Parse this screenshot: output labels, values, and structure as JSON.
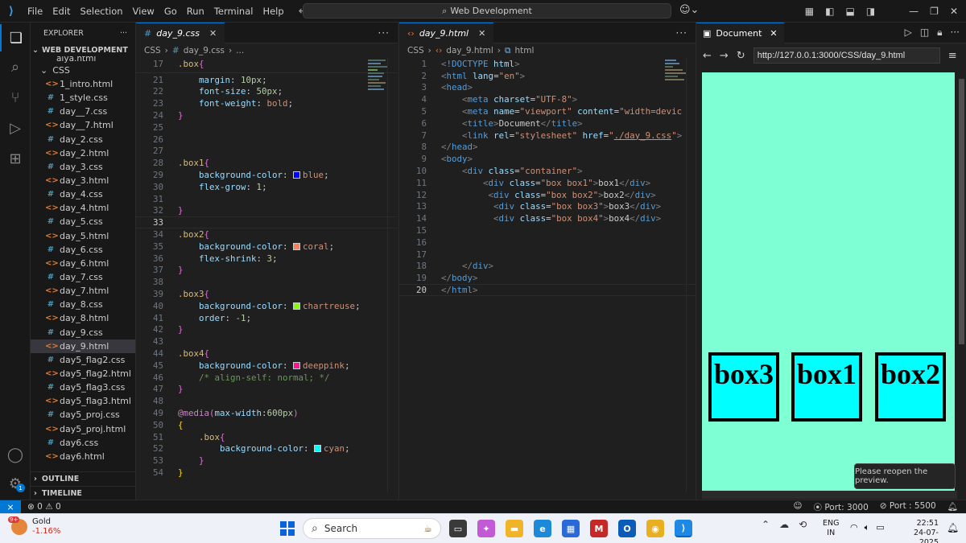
{
  "titlebar": {
    "menu": [
      "File",
      "Edit",
      "Selection",
      "View",
      "Go",
      "Run",
      "Terminal",
      "Help"
    ],
    "search": "Web Development"
  },
  "explorer": {
    "header": "EXPLORER",
    "folder": "WEB DEVELOPMENT",
    "clipped_item": "aiya.html",
    "subfolder": "CSS",
    "files": [
      {
        "name": "1_intro.html",
        "type": "html"
      },
      {
        "name": "1_style.css",
        "type": "css"
      },
      {
        "name": "day__7.css",
        "type": "css"
      },
      {
        "name": "day__7.html",
        "type": "html"
      },
      {
        "name": "day_2.css",
        "type": "css"
      },
      {
        "name": "day_2.html",
        "type": "html"
      },
      {
        "name": "day_3.css",
        "type": "css"
      },
      {
        "name": "day_3.html",
        "type": "html"
      },
      {
        "name": "day_4.css",
        "type": "css"
      },
      {
        "name": "day_4.html",
        "type": "html"
      },
      {
        "name": "day_5.css",
        "type": "css"
      },
      {
        "name": "day_5.html",
        "type": "html"
      },
      {
        "name": "day_6.css",
        "type": "css"
      },
      {
        "name": "day_6.html",
        "type": "html"
      },
      {
        "name": "day_7.css",
        "type": "css"
      },
      {
        "name": "day_7.html",
        "type": "html"
      },
      {
        "name": "day_8.css",
        "type": "css"
      },
      {
        "name": "day_8.html",
        "type": "html"
      },
      {
        "name": "day_9.css",
        "type": "css"
      },
      {
        "name": "day_9.html",
        "type": "html",
        "selected": true
      },
      {
        "name": "day5_flag2.css",
        "type": "css"
      },
      {
        "name": "day5_flag2.html",
        "type": "html"
      },
      {
        "name": "day5_flag3.css",
        "type": "css"
      },
      {
        "name": "day5_flag3.html",
        "type": "html"
      },
      {
        "name": "day5_proj.css",
        "type": "css"
      },
      {
        "name": "day5_proj.html",
        "type": "html"
      },
      {
        "name": "day6.css",
        "type": "css"
      },
      {
        "name": "day6.html",
        "type": "html"
      }
    ],
    "outline": "OUTLINE",
    "timeline": "TIMELINE"
  },
  "css_editor": {
    "tab": "day_9.css",
    "breadcrumb": [
      "CSS",
      "#",
      "day_9.css",
      "..."
    ],
    "current_line": "33"
  },
  "html_editor": {
    "tab": "day_9.html",
    "breadcrumb": [
      "CSS",
      "day_9.html",
      "html"
    ],
    "current_line": "20"
  },
  "preview": {
    "tab": "Document",
    "url": "http://127.0.0.1:3000/CSS/day_9.html",
    "boxes": [
      "box3",
      "box1",
      "box2"
    ],
    "tooltip": "Please reopen the preview."
  },
  "statusbar": {
    "problems": "0",
    "warnings": "0",
    "port1": "Port: 3000",
    "port2": "Port : 5500"
  },
  "taskbar": {
    "weather_title": "Gold",
    "weather_change": "-1.16%",
    "weather_badge": "9+",
    "search": "Search",
    "lang_top": "ENG",
    "lang_bottom": "IN",
    "time": "22:51",
    "date": "24-07-2025"
  },
  "colors": {
    "preview_bg": "#7fffd4",
    "box_bg": "#00ffff",
    "accent": "#0078d4"
  }
}
